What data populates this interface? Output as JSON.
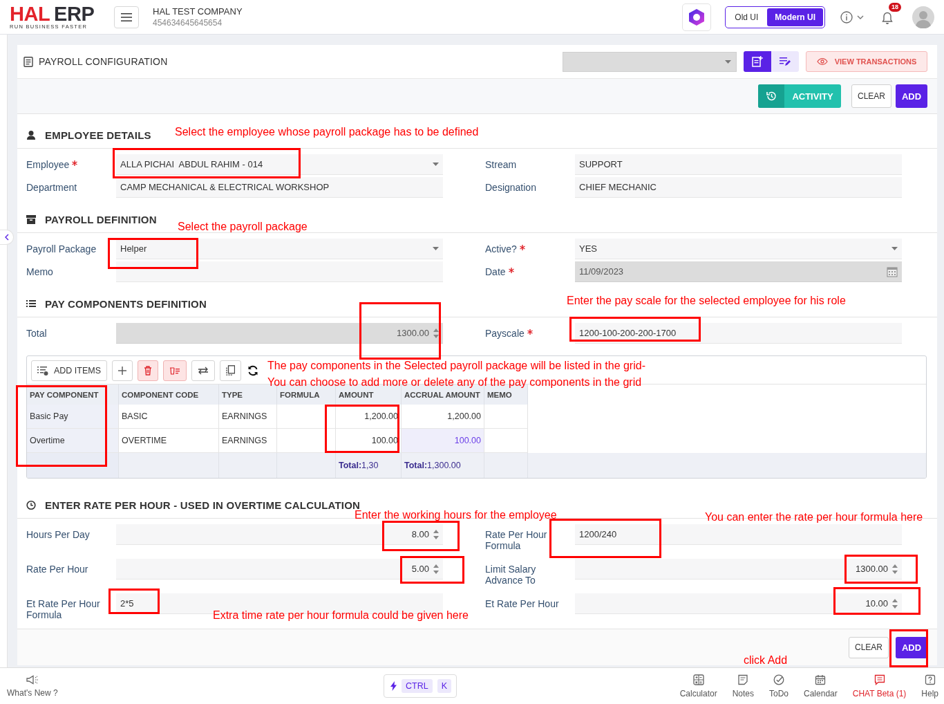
{
  "header": {
    "logo_mark": "HAL",
    "logo_text": "ERP",
    "tagline": "RUN BUSINESS FASTER",
    "company": "HAL TEST COMPANY",
    "company_id": "454634645645654",
    "ui_toggle": [
      {
        "label": "Old UI",
        "selected": false
      },
      {
        "label": "Modern UI",
        "selected": true
      }
    ],
    "notifications": "18"
  },
  "page": {
    "title": "PAYROLL CONFIGURATION",
    "view_transactions": "VIEW TRANSACTIONS",
    "activity": "ACTIVITY",
    "clear": "CLEAR",
    "add": "ADD"
  },
  "sections": [
    {
      "title": "EMPLOYEE DETAILS",
      "rows": [
        [
          {
            "label": "Employee",
            "required": true,
            "kind": "select",
            "value": "ALLA PICHAI  ABDUL RAHIM - 014",
            "disabled": false
          },
          {
            "label": "Stream",
            "required": false,
            "kind": "text",
            "value": "SUPPORT",
            "disabled": false
          }
        ],
        [
          {
            "label": "Department",
            "required": false,
            "kind": "text",
            "value": "CAMP MECHANICAL & ELECTRICAL WORKSHOP",
            "disabled": false
          },
          {
            "label": "Designation",
            "required": false,
            "kind": "text",
            "value": "CHIEF MECHANIC",
            "disabled": false
          }
        ]
      ]
    },
    {
      "title": "PAYROLL DEFINITION",
      "rows": [
        [
          {
            "label": "Payroll Package",
            "required": false,
            "kind": "select",
            "value": "Helper",
            "disabled": false
          },
          {
            "label": "Active?",
            "required": true,
            "kind": "select",
            "value": "YES",
            "disabled": false
          }
        ],
        [
          {
            "label": "Memo",
            "required": false,
            "kind": "text",
            "disabled": false
          },
          {
            "label": "Date",
            "required": true,
            "kind": "date",
            "value": "11/09/2023",
            "disabled": true
          }
        ]
      ]
    },
    {
      "title": "PAY COMPONENTS DEFINITION",
      "rows": [
        [
          {
            "label": "Total",
            "required": false,
            "kind": "number",
            "value": "1300.00",
            "disabled": true
          },
          {
            "label": "Payscale",
            "required": true,
            "kind": "text",
            "value": "1200-100-200-200-1700",
            "disabled": false
          }
        ]
      ],
      "grid": {
        "toolbar": [
          {
            "kind": "add_items",
            "label": "ADD ITEMS"
          },
          {
            "kind": "add"
          },
          {
            "kind": "delete"
          },
          {
            "kind": "delete_rows"
          },
          {
            "kind": "swap"
          },
          {
            "kind": "copy"
          },
          {
            "kind": "refresh"
          }
        ],
        "columns": [
          "PAY COMPONENT",
          "COMPONENT CODE",
          "TYPE",
          "FORMULA",
          "AMOUNT",
          "ACCRUAL AMOUNT",
          "MEMO"
        ],
        "rows": [
          {
            "pay_component": "Basic Pay",
            "component_code": "BASIC",
            "type": "EARNINGS",
            "amount": "1,200.00",
            "accrual_amount": "1,200.00",
            "accrual_focused": false
          },
          {
            "pay_component": "Overtime",
            "component_code": "OVERTIME",
            "type": "EARNINGS",
            "amount": "100.00",
            "accrual_amount": "100.00",
            "accrual_focused": true
          }
        ],
        "totals": {
          "amount": "**Total:**1,30",
          "accrual_amount": "**Total:**1,300.00"
        }
      }
    },
    {
      "title": "ENTER RATE PER HOUR - USED IN OVERTIME CALCULATION",
      "rows": [
        [
          {
            "label": "Hours Per Day",
            "required": false,
            "kind": "number",
            "value": "8.00",
            "disabled": false
          },
          {
            "label": "Rate Per Hour Formula",
            "required": false,
            "kind": "text",
            "value": "1200/240",
            "disabled": false
          }
        ],
        [
          {
            "label": "Rate Per Hour",
            "required": false,
            "kind": "number",
            "value": "5.00",
            "disabled": false
          },
          {
            "label": "Limit Salary Advance To",
            "required": false,
            "kind": "number",
            "value": "1300.00",
            "disabled": false
          }
        ],
        [
          {
            "label": "Et Rate Per Hour Formula",
            "required": false,
            "kind": "text",
            "value": "2*5",
            "disabled": false
          },
          {
            "label": "Et Rate Per Hour",
            "required": false,
            "kind": "number",
            "value": "10.00",
            "disabled": false
          }
        ]
      ]
    }
  ],
  "bottom": {
    "clear": "CLEAR",
    "add": "ADD"
  },
  "footer": {
    "whats_new": "What's New ?",
    "shortcut": [
      "CTRL",
      "K"
    ],
    "items": [
      {
        "label": "Calculator",
        "unread": false
      },
      {
        "label": "Notes",
        "unread": false
      },
      {
        "label": "ToDo",
        "unread": false
      },
      {
        "label": "Calendar",
        "unread": false
      },
      {
        "label": "CHAT Beta (1)",
        "unread": true
      },
      {
        "label": "Help",
        "unread": false
      }
    ]
  },
  "annotations": [
    {
      "text": "Select the employee whose payroll package has to be defined"
    },
    {
      "text": "Select the payroll package"
    },
    {
      "text": "Enter the pay scale for the selected employee for his role"
    },
    {
      "text": "The pay components in the Selected payroll package will be listed in the grid-"
    },
    {
      "text": "You can choose to add more or delete any of the pay components in the grid"
    },
    {
      "text": "Enter the working hours for the employee"
    },
    {
      "text": "You can enter the rate per hour formula here"
    },
    {
      "text": "Extra time rate per hour formula could be given here"
    },
    {
      "text": "click Add"
    }
  ]
}
